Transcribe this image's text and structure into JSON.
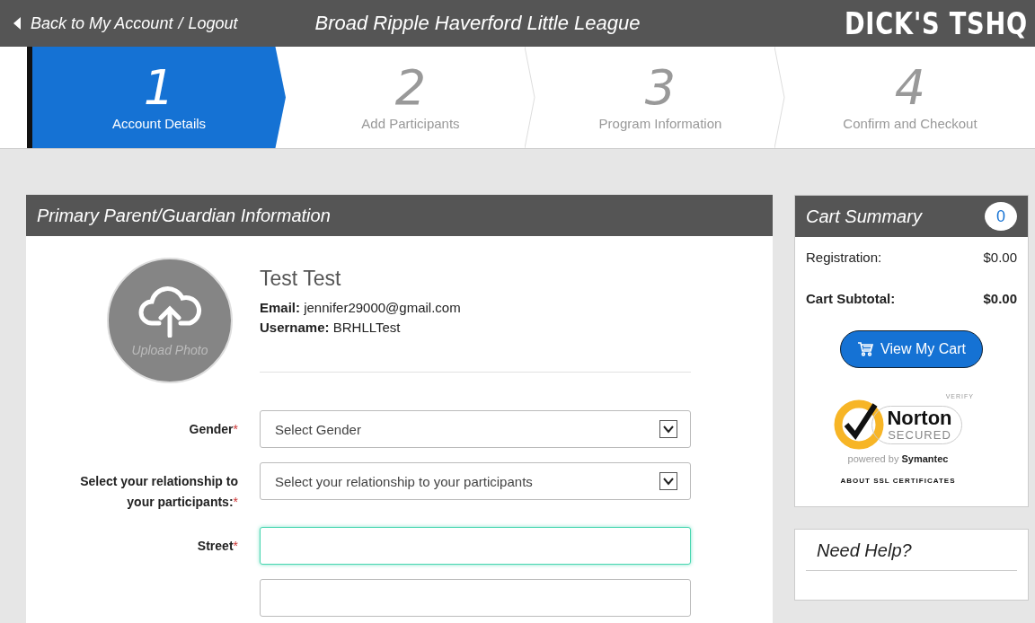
{
  "header": {
    "back_link": "Back to My Account",
    "separator": "/",
    "logout_link": "Logout",
    "title": "Broad Ripple Haverford Little League",
    "logo": "DICK'S TSHQ"
  },
  "steps": [
    {
      "number": "1",
      "label": "Account Details",
      "selected": true
    },
    {
      "number": "2",
      "label": "Add Participants",
      "selected": false
    },
    {
      "number": "3",
      "label": "Program Information",
      "selected": false
    },
    {
      "number": "4",
      "label": "Confirm and Checkout",
      "selected": false
    }
  ],
  "main_panel": {
    "title": "Primary Parent/Guardian Information",
    "upload_photo": "Upload Photo",
    "name": "Test Test",
    "details": [
      {
        "label": "Email:",
        "value": "jennifer29000@gmail.com"
      },
      {
        "label": "Username:",
        "value": "BRHLLTest"
      }
    ],
    "fields": [
      {
        "kind": "select",
        "label": "Gender",
        "required_mark": "*",
        "value": "Select Gender",
        "focused": false
      },
      {
        "kind": "select",
        "label": "Select your relationship to your participants:",
        "required_mark": "*",
        "value": "Select your relationship to your participants",
        "focused": false
      },
      {
        "kind": "text",
        "label": "Street",
        "required_mark": "*",
        "focused": true
      },
      {
        "kind": "text",
        "focused": false
      }
    ]
  },
  "cart_summary": {
    "title": "Cart Summary",
    "count": "0",
    "rows": [
      {
        "label": "Registration:",
        "value": "$0.00",
        "bold": false
      },
      {
        "label": "Cart Subtotal:",
        "value": "$0.00",
        "bold": true
      }
    ],
    "button": "View My Cart",
    "seal": {
      "verify": "VERIFY",
      "brand": "Norton",
      "secured": "SECURED",
      "powered_by": "powered by",
      "company": "Symantec",
      "link": "ABOUT SSL CERTIFICATES"
    }
  },
  "help": {
    "title": "Need Help?"
  }
}
